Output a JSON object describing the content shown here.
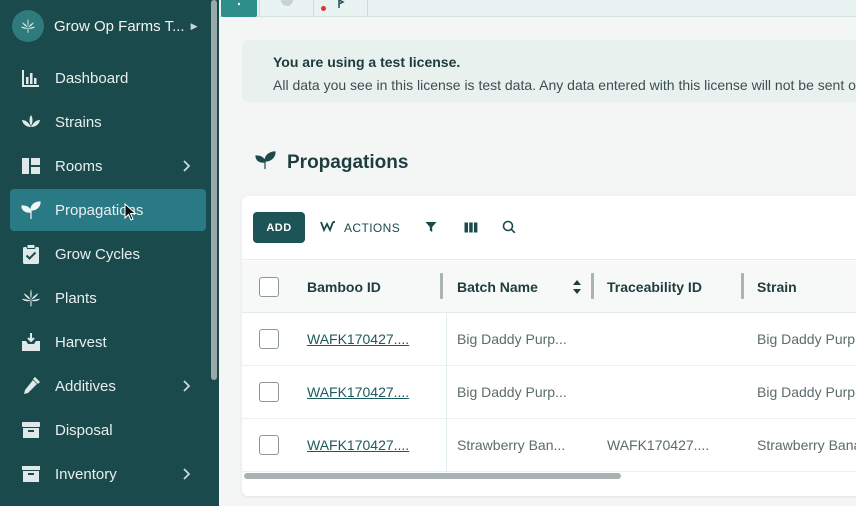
{
  "org": {
    "name": "Grow Op Farms T...",
    "logo_icon": "cannabis-leaf-icon"
  },
  "sidebar": {
    "items": [
      {
        "label": "Dashboard",
        "icon": "bar-chart-icon",
        "has_submenu": false,
        "active": false
      },
      {
        "label": "Strains",
        "icon": "lotus-icon",
        "has_submenu": false,
        "active": false
      },
      {
        "label": "Rooms",
        "icon": "layout-icon",
        "has_submenu": true,
        "active": false
      },
      {
        "label": "Propagations",
        "icon": "sprout-icon",
        "has_submenu": false,
        "active": true
      },
      {
        "label": "Grow Cycles",
        "icon": "clipboard-check-icon",
        "has_submenu": false,
        "active": false
      },
      {
        "label": "Plants",
        "icon": "cannabis-leaf-icon",
        "has_submenu": false,
        "active": false
      },
      {
        "label": "Harvest",
        "icon": "harvest-tray-icon",
        "has_submenu": false,
        "active": false
      },
      {
        "label": "Additives",
        "icon": "dropper-icon",
        "has_submenu": true,
        "active": false
      },
      {
        "label": "Disposal",
        "icon": "bin-icon",
        "has_submenu": false,
        "active": false
      },
      {
        "label": "Inventory",
        "icon": "archive-box-icon",
        "has_submenu": true,
        "active": false
      }
    ]
  },
  "banner": {
    "title": "You are using a test license.",
    "text": "All data you see in this license is test data. Any data entered with this license will not be sent ou"
  },
  "page": {
    "title": "Propagations",
    "icon": "sprout-icon"
  },
  "toolbar": {
    "add_label": "ADD",
    "actions_label": "ACTIONS",
    "filter_icon": "filter-icon",
    "columns_icon": "columns-icon",
    "search_icon": "search-icon"
  },
  "table": {
    "columns": [
      "Bamboo ID",
      "Batch Name",
      "Traceability ID",
      "Strain"
    ],
    "rows": [
      {
        "bamboo_id": "WAFK170427....",
        "batch_name": "Big Daddy Purp...",
        "traceability_id": "",
        "strain": "Big Daddy Purp"
      },
      {
        "bamboo_id": "WAFK170427....",
        "batch_name": "Big Daddy Purp...",
        "traceability_id": "",
        "strain": "Big Daddy Purp"
      },
      {
        "bamboo_id": "WAFK170427....",
        "batch_name": "Strawberry Ban...",
        "traceability_id": "WAFK170427....",
        "strain": "Strawberry Bana"
      }
    ]
  },
  "colors": {
    "sidebar_bg": "#1b4a4d",
    "active_item_bg": "#2a7a86",
    "primary_button": "#1d5457",
    "banner_bg": "#e9f1ef"
  }
}
